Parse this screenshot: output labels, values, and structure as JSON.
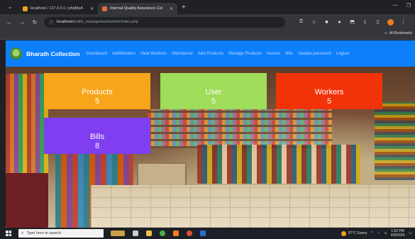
{
  "browser": {
    "tabs": [
      {
        "title": "localhost / 127.0.0.1 | phpMyA",
        "favicon_color": "#f0a020"
      },
      {
        "title": "Internal Quality Assurance Cel",
        "favicon_color": "#e8683a"
      }
    ],
    "address": {
      "host": "localhost",
      "path": "/textile_management/admin/index.php"
    },
    "bookmarks_label": "All Bookmarks"
  },
  "navbar": {
    "brand": "Bharath Collection",
    "links": [
      "Dashboard",
      "AddWorkers",
      "View Workers",
      "Attendance",
      "Add Products",
      "Manage Products",
      "Invoice",
      "Bills",
      "Update password",
      "Logout"
    ],
    "color": "#0d7ffb"
  },
  "cards": {
    "products": {
      "label": "Products",
      "value": "5",
      "color": "#f7a51a"
    },
    "user": {
      "label": "User",
      "value": "5",
      "color": "#9fdd5a"
    },
    "workers": {
      "label": "Workers",
      "value": "5",
      "color": "#f2330a"
    },
    "bills": {
      "label": "Bills",
      "value": "8",
      "color": "#7f3ff0"
    }
  },
  "taskbar": {
    "search_placeholder": "Type here to search",
    "weather": "37°C Sunny",
    "time": "1:52 PM",
    "date": "4/9/2024"
  }
}
